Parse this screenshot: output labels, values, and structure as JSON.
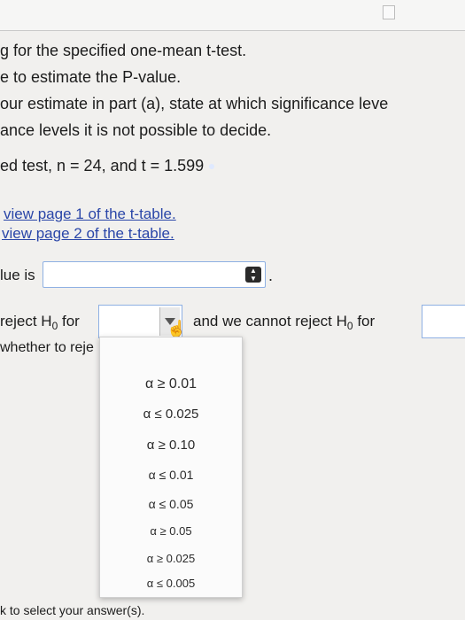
{
  "question": {
    "lines": [
      "g for the specified one-mean t-test.",
      "e to estimate the P-value.",
      "our estimate in part (a), state at which significance leve",
      "ance levels it is not possible to decide."
    ],
    "test_info": "ed test, n = 24, and t = 1.599"
  },
  "links": {
    "page1": "view page 1 of the t-table.",
    "page2": "view page 2 of the t-table."
  },
  "pvalue": {
    "label": "lue is",
    "after": "."
  },
  "decision": {
    "reject_prefix": "reject H",
    "subscript": "0",
    "for": "for",
    "cannot_text": "and we cannot reject H",
    "cannot_for": "for",
    "whether_text": "whether to reje"
  },
  "dropdown": {
    "options": [
      "α ≥ 0.01",
      "α ≤ 0.025",
      "α ≥ 0.10",
      "α ≤ 0.01",
      "α ≤ 0.05",
      "α ≥ 0.05",
      "α ≥ 0.025",
      "α ≤ 0.005"
    ]
  },
  "footer": {
    "instruction": "k to select your answer(s)."
  },
  "icons": {
    "select_arrows": "updown-icon",
    "dropdown_arrow": "triangle-down-icon",
    "pointer": "hand-pointer-icon"
  }
}
